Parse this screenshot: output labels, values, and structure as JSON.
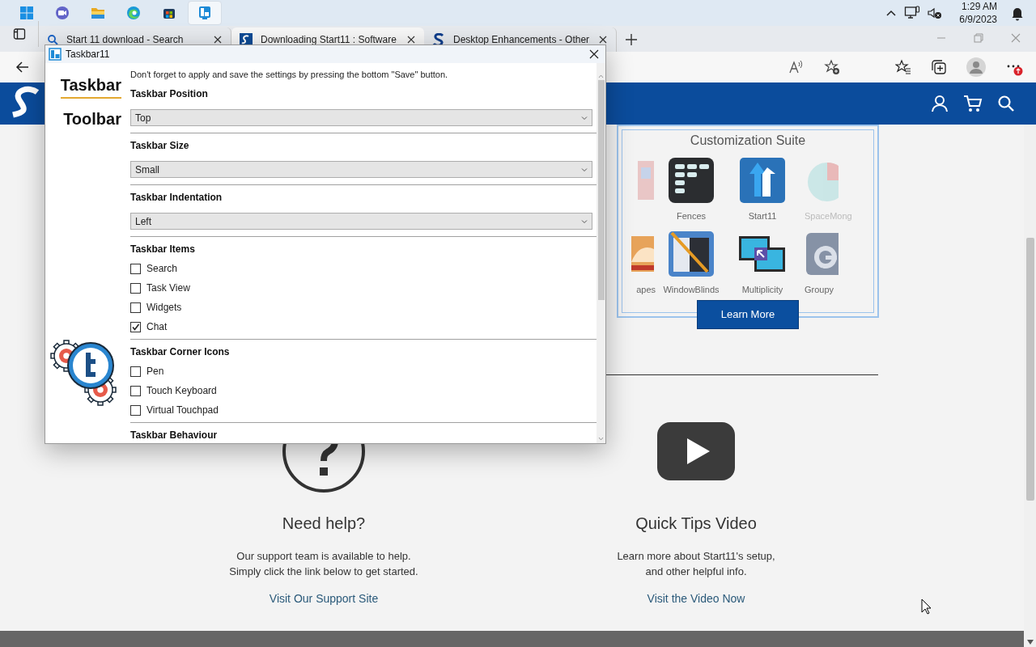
{
  "taskbar": {
    "time": "1:29 AM",
    "date": "6/9/2023"
  },
  "browser": {
    "tabs": [
      {
        "title": "Start 11 download - Search",
        "selected": false
      },
      {
        "title": "Downloading Start11 : Software",
        "selected": true
      },
      {
        "title": "Desktop Enhancements - Other",
        "selected": false
      }
    ]
  },
  "site": {
    "promo": {
      "heading": "Customization Suite",
      "rows": [
        [
          "",
          "Fences",
          "Start11",
          "SpaceMong"
        ],
        [
          "apes",
          "WindowBlinds",
          "Multiplicity",
          "Groupy"
        ]
      ],
      "button": "Learn More"
    },
    "panels": [
      {
        "kind": "help",
        "title": "Need help?",
        "lines": [
          "Our support team is available to help.",
          "Simply click the link below to get started."
        ],
        "link": "Visit Our Support Site"
      },
      {
        "kind": "video",
        "title": "Quick Tips Video",
        "lines": [
          "Learn more about Start11's setup,",
          "and other helpful info."
        ],
        "link": "Visit the Video Now"
      }
    ]
  },
  "dialog": {
    "title": "Taskbar11",
    "nav": [
      {
        "label": "Taskbar",
        "selected": true
      },
      {
        "label": "Toolbar",
        "selected": false
      }
    ],
    "note": "Don't forget to apply and save the settings by pressing the bottom \"Save\" button.",
    "sections": [
      {
        "kind": "select",
        "heading": "Taskbar Position",
        "value": "Top"
      },
      {
        "kind": "select",
        "heading": "Taskbar Size",
        "value": "Small"
      },
      {
        "kind": "select",
        "heading": "Taskbar Indentation",
        "value": "Left"
      },
      {
        "kind": "checks",
        "heading": "Taskbar Items",
        "items": [
          {
            "label": "Search",
            "checked": false
          },
          {
            "label": "Task View",
            "checked": false
          },
          {
            "label": "Widgets",
            "checked": false
          },
          {
            "label": "Chat",
            "checked": true
          }
        ]
      },
      {
        "kind": "checks",
        "heading": "Taskbar Corner Icons",
        "items": [
          {
            "label": "Pen",
            "checked": false
          },
          {
            "label": "Touch Keyboard",
            "checked": false
          },
          {
            "label": "Virtual Touchpad",
            "checked": false
          }
        ]
      },
      {
        "kind": "heading",
        "heading": "Taskbar Behaviour"
      }
    ]
  }
}
